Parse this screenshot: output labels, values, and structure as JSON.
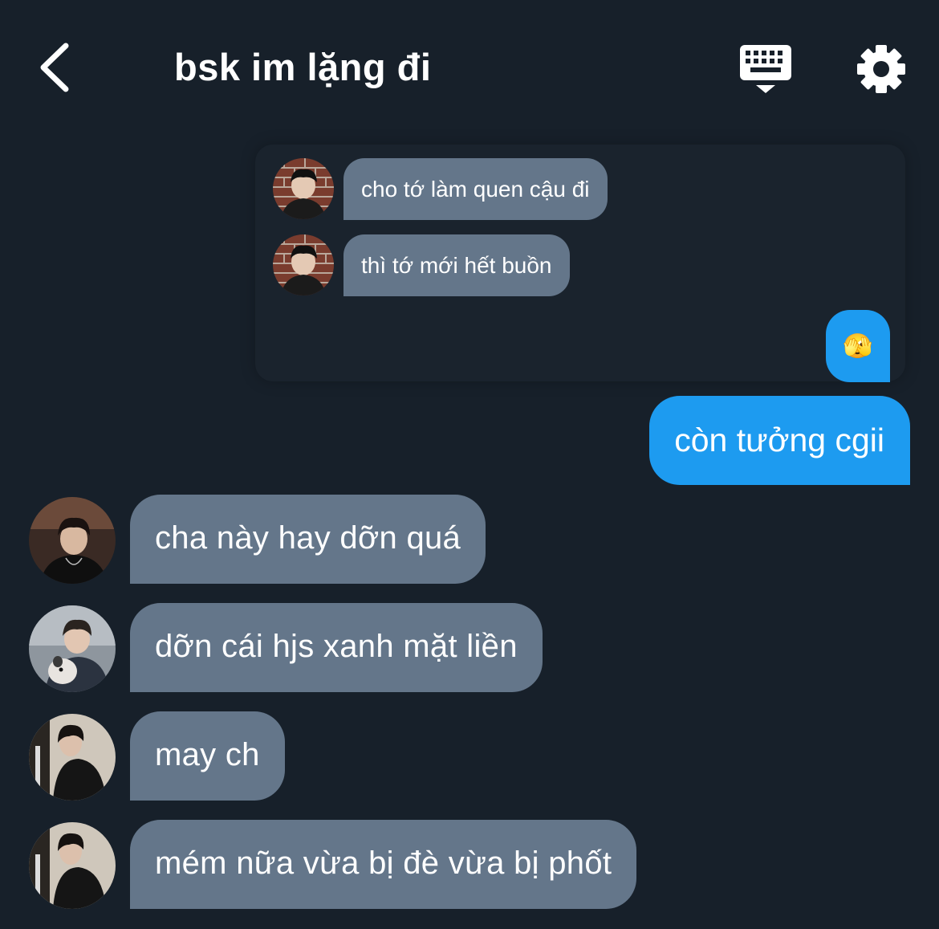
{
  "header": {
    "back_icon": "chevron-left-icon",
    "title": "bsk im lặng đi",
    "keyboard_icon": "keyboard-icon",
    "settings_icon": "gear-icon"
  },
  "quoted_story": {
    "messages": [
      {
        "text": "cho tớ làm quen cậu đi",
        "avatar": "avatar-brick-wall"
      },
      {
        "text": "thì tớ mới hết buồn",
        "avatar": "avatar-brick-wall"
      }
    ],
    "reaction": "🫣"
  },
  "outgoing": {
    "text": "còn tưởng cgii"
  },
  "incoming": [
    {
      "text": "cha này hay dỡn quá",
      "avatar": "avatar-dark-portrait"
    },
    {
      "text": "dỡn cái hjs xanh mặt liền",
      "avatar": "avatar-with-pet"
    },
    {
      "text": "may ch",
      "avatar": "avatar-leaning-wall"
    },
    {
      "text": "mém nữa vừa bị đè vừa bị phốt",
      "avatar": "avatar-leaning-wall"
    }
  ],
  "colors": {
    "background": "#17202a",
    "incoming_bubble": "#64768a",
    "outgoing_bubble": "#1d9bf0",
    "text": "#ffffff"
  }
}
